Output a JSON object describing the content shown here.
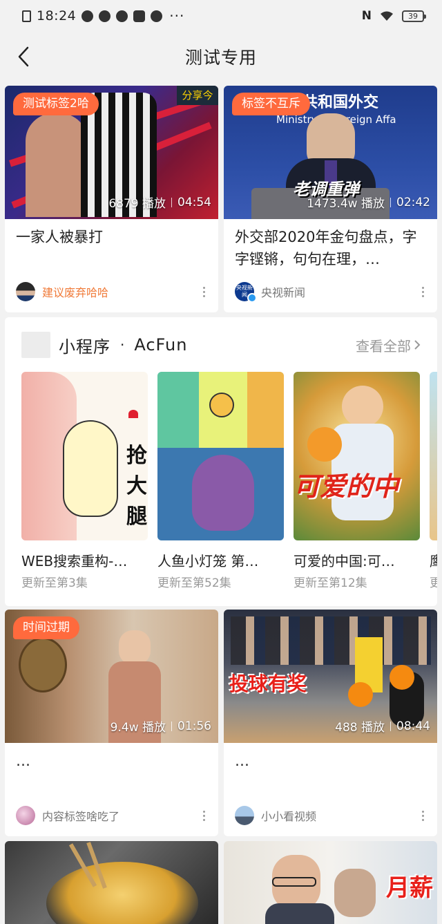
{
  "status_bar": {
    "time": "18:24",
    "dots": "···",
    "nfc": "N",
    "battery": "39"
  },
  "nav": {
    "title": "测试专用"
  },
  "cards": [
    {
      "tag": "测试标签2哈",
      "views": "6879 播放",
      "duration": "04:54",
      "title": "一家人被暴打",
      "author": "建议废弃哈哈",
      "overlay_text": "分享今"
    },
    {
      "tag": "标签不互斥",
      "views": "1473.4w 播放",
      "duration": "02:42",
      "title": "外交部2020年金句盘点，字字铿锵，句句在理，…",
      "author": "央视新闻",
      "overlay_text": "人民共和国外交",
      "overlay_text_en": "Ministry of Foreign Affa",
      "overlay_caption": "老调重弹",
      "avatar_text": "央视新闻"
    },
    {
      "tag": "时间过期",
      "views": "9.4w 播放",
      "duration": "01:56",
      "title": "…",
      "author": "内容标签啥吃了"
    },
    {
      "views": "488 播放",
      "duration": "08:44",
      "title": "…",
      "author": "小小看视频",
      "overlay_caption": "投球有奖"
    },
    {
      "overlay_caption": "月薪"
    }
  ],
  "mini_program": {
    "title": "小程序",
    "separator": "·",
    "name": "AcFun",
    "see_all": "查看全部",
    "items": [
      {
        "name": "WEB搜索重构-…",
        "sub": "更新至第3集"
      },
      {
        "name": "人鱼小灯笼 第…",
        "sub": "更新至第52集"
      },
      {
        "name": "可爱的中国:可…",
        "sub": "更新至第12集"
      },
      {
        "name": "鹰",
        "sub": "更"
      }
    ]
  }
}
